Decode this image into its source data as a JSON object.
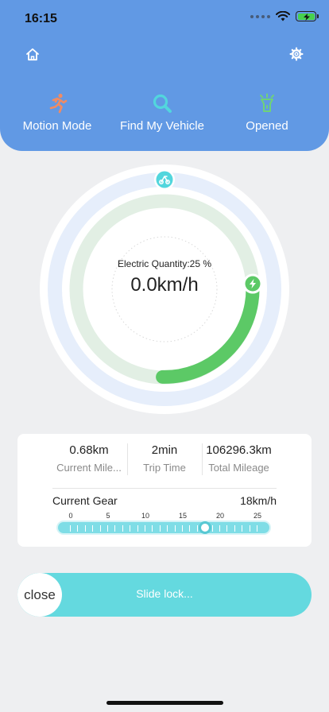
{
  "status_bar": {
    "time": "16:15"
  },
  "modes": [
    {
      "label": "Motion Mode",
      "icon": "running-person-icon",
      "color": "#f08b63"
    },
    {
      "label": "Find My Vehicle",
      "icon": "search-icon",
      "color": "#52d6dd"
    },
    {
      "label": "Opened",
      "icon": "flashlight-icon",
      "color": "#6fd27a"
    }
  ],
  "gauge": {
    "label": "Electric Quantity:25 %",
    "speed": "0.0km/h",
    "battery_fraction": 0.25,
    "colors": {
      "progress": "#5cc966",
      "track": "#e2efe4",
      "outer": "#e6eefb"
    }
  },
  "stats": [
    {
      "value": "0.68km",
      "caption": "Current Mile..."
    },
    {
      "value": "2min",
      "caption": "Trip Time"
    },
    {
      "value": "106296.3km",
      "caption": "Total Mileage"
    }
  ],
  "gear": {
    "title": "Current Gear",
    "speed": "18km/h",
    "scale": [
      "0",
      "5",
      "10",
      "15",
      "20",
      "25"
    ],
    "min": 0,
    "max": 25,
    "value": 18
  },
  "slide_lock": {
    "knob_label": "close",
    "text": "Slide lock..."
  },
  "colors": {
    "header": "#6199e4",
    "accent": "#64d9df",
    "background": "#eeeff1"
  }
}
